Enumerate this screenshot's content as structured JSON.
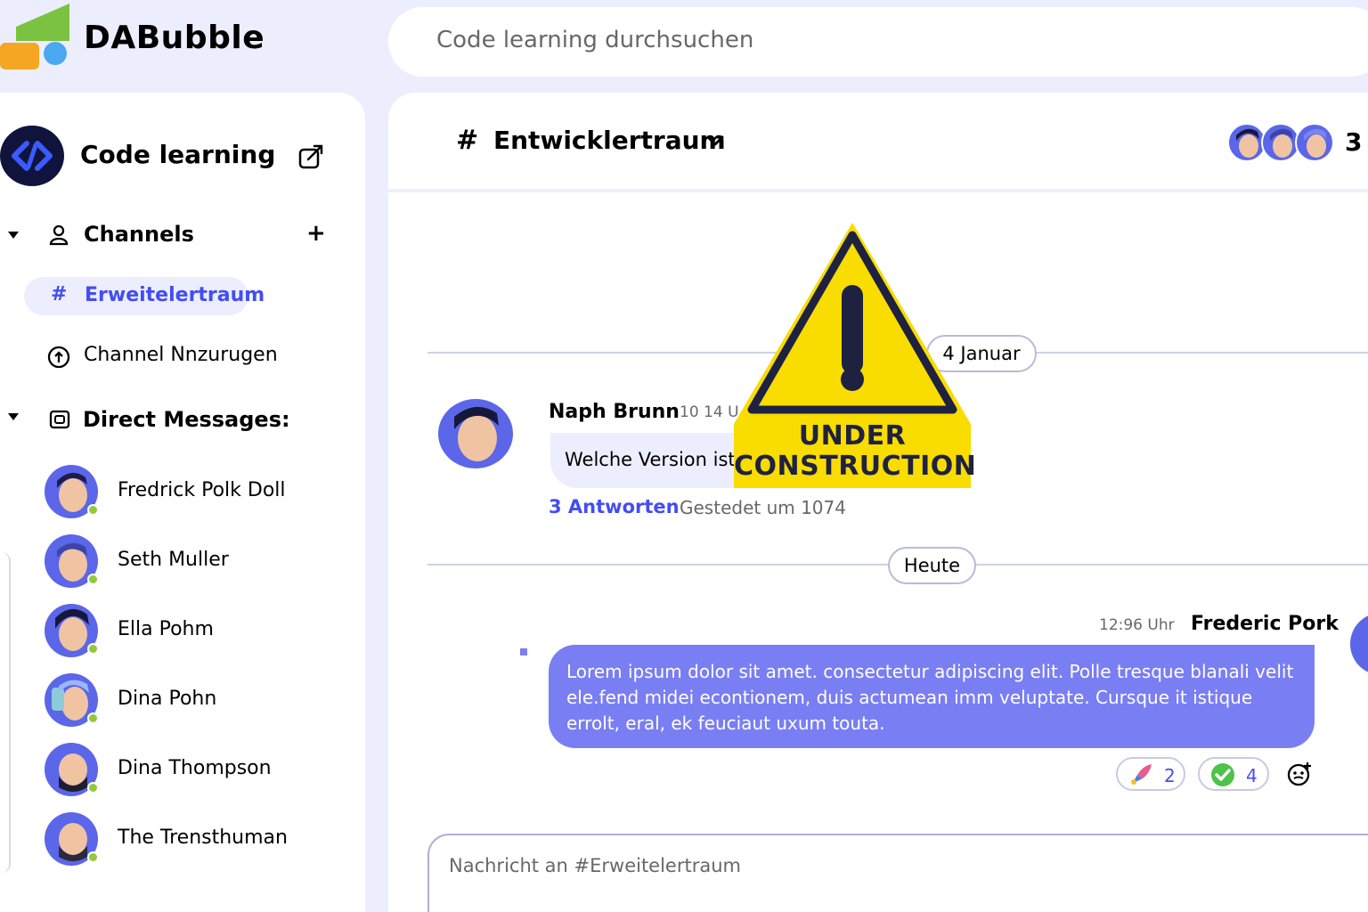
{
  "app": {
    "name": "DABubble"
  },
  "search": {
    "placeholder": "Code learning durchsuchen"
  },
  "workspace": {
    "name": "Code learning"
  },
  "sidebar": {
    "channels_label": "Channels",
    "active_channel": "Erweitelertraum",
    "add_channel_label": "Channel Nnzurugen",
    "dm_label": "Direct Messages:",
    "direct_messages": [
      {
        "name": "Fredrick Polk Doll",
        "online": true
      },
      {
        "name": "Seth Muller",
        "online": true
      },
      {
        "name": "Ella Pohm",
        "online": true
      },
      {
        "name": "Dina Pohn",
        "online": true
      },
      {
        "name": "Dina Thompson",
        "online": true
      },
      {
        "name": "The Trensthuman",
        "online": true
      }
    ]
  },
  "channel": {
    "hash": "#",
    "title": "Entwicklertraum",
    "member_count": "3"
  },
  "messages": {
    "date_old": "4 Januar",
    "first": {
      "author": "Naph Brunn",
      "time": "10 14 U",
      "text": "Welche Version ist",
      "replies": "3 Antworten",
      "reply_info": "Gestedet um 1074"
    },
    "date_today": "Heute",
    "own": {
      "time": "12:96 Uhr",
      "author": "Frederic Pork",
      "text": "Lorem ipsum dolor sit amet. consectetur adipiscing elit. Polle tresque blanali velit ele.fend midei econtionem, duis actumean imm veluptate. Cursque it istique errolt, eral, ek feuciaut uxum touta."
    },
    "reactions": [
      {
        "icon": "rocket-emoji",
        "count": "2"
      },
      {
        "icon": "check-emoji",
        "count": "4"
      }
    ]
  },
  "composer": {
    "placeholder": "Nachricht an #Erweitelertraum"
  },
  "overlay": {
    "line1": "UNDER",
    "line2": "CONSTRUCTION"
  },
  "colors": {
    "accent": "#444df2",
    "bubble": "#797ef3",
    "background": "#eceefe",
    "online": "#92c83e",
    "warning": "#f9dc00"
  }
}
